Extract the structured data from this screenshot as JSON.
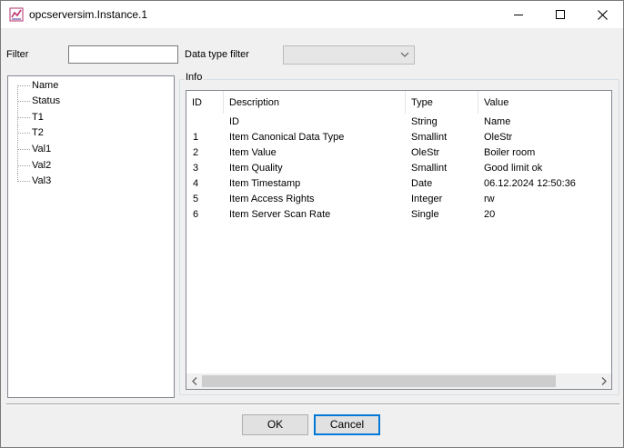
{
  "window": {
    "title": "opcserversim.Instance.1",
    "icon": "app-icon"
  },
  "filter": {
    "label": "Filter",
    "value": ""
  },
  "data_type_filter": {
    "label": "Data type filter",
    "selected": ""
  },
  "tree": {
    "items": [
      "Name",
      "Status",
      "T1",
      "T2",
      "Val1",
      "Val2",
      "Val3"
    ]
  },
  "info": {
    "legend": "Info",
    "columns": [
      "ID",
      "Description",
      "Type",
      "Value"
    ],
    "rows": [
      {
        "id": "",
        "description": "ID",
        "type": "String",
        "value": "Name"
      },
      {
        "id": "1",
        "description": "Item Canonical Data Type",
        "type": "Smallint",
        "value": "OleStr"
      },
      {
        "id": "2",
        "description": "Item Value",
        "type": "OleStr",
        "value": "Boiler room"
      },
      {
        "id": "3",
        "description": "Item Quality",
        "type": "Smallint",
        "value": "Good limit ok"
      },
      {
        "id": "4",
        "description": "Item Timestamp",
        "type": "Date",
        "value": "06.12.2024 12:50:36"
      },
      {
        "id": "5",
        "description": "Item Access Rights",
        "type": "Integer",
        "value": "rw"
      },
      {
        "id": "6",
        "description": "Item Server Scan Rate",
        "type": "Single",
        "value": "20"
      }
    ]
  },
  "buttons": {
    "ok": "OK",
    "cancel": "Cancel"
  }
}
